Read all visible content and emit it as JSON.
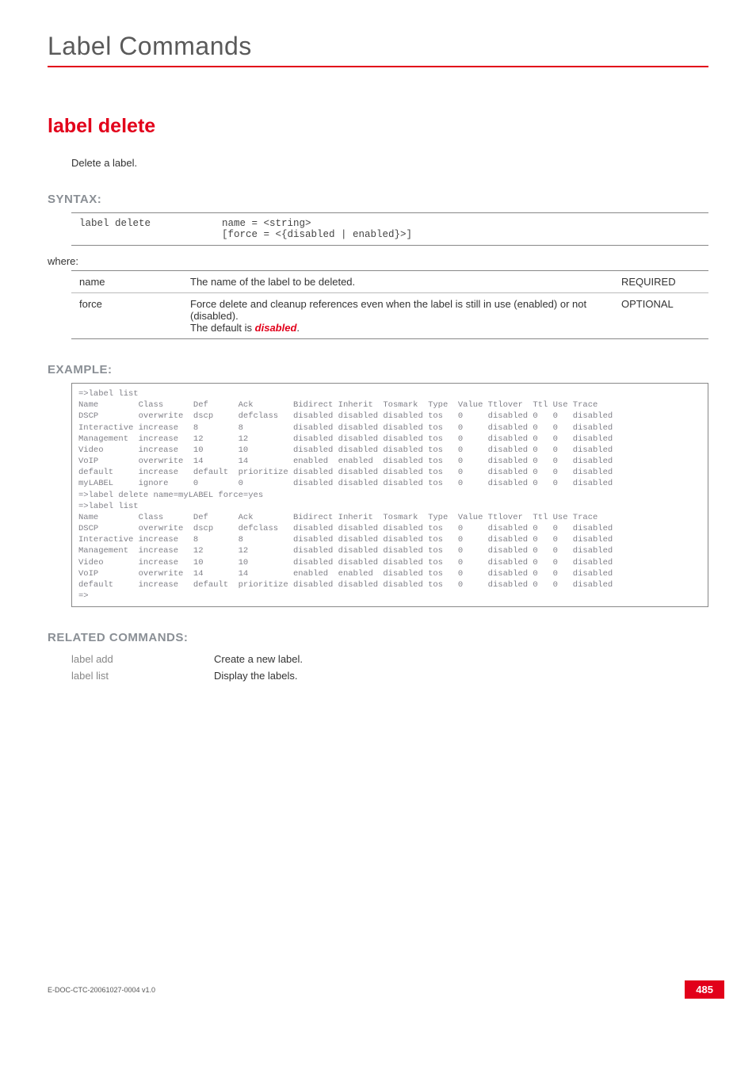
{
  "header": {
    "chapter": "Label Commands"
  },
  "title": "label delete",
  "description": "Delete a label.",
  "sections": {
    "syntax": "SYNTAX:",
    "example": "EXAMPLE:",
    "related": "RELATED COMMANDS:"
  },
  "syntax": {
    "cmd": "label delete",
    "args": "name = <string>\n[force = <{disabled | enabled}>]"
  },
  "where_label": "where:",
  "params": [
    {
      "name": "name",
      "desc_plain": "The name of the label to be deleted.",
      "req": "REQUIRED"
    },
    {
      "name": "force",
      "desc_pre": "Force delete and cleanup references even when the label is still in use (enabled) or not (disabled).\nThe default is ",
      "desc_kw": "disabled",
      "desc_post": ".",
      "req": "OPTIONAL"
    }
  ],
  "example_text": "=>label list\nName        Class      Def      Ack        Bidirect Inherit  Tosmark  Type  Value Ttlover  Ttl Use Trace\nDSCP        overwrite  dscp     defclass   disabled disabled disabled tos   0     disabled 0   0   disabled\nInteractive increase   8        8          disabled disabled disabled tos   0     disabled 0   0   disabled\nManagement  increase   12       12         disabled disabled disabled tos   0     disabled 0   0   disabled\nVideo       increase   10       10         disabled disabled disabled tos   0     disabled 0   0   disabled\nVoIP        overwrite  14       14         enabled  enabled  disabled tos   0     disabled 0   0   disabled\ndefault     increase   default  prioritize disabled disabled disabled tos   0     disabled 0   0   disabled\nmyLABEL     ignore     0        0          disabled disabled disabled tos   0     disabled 0   0   disabled\n=>label delete name=myLABEL force=yes\n=>label list\nName        Class      Def      Ack        Bidirect Inherit  Tosmark  Type  Value Ttlover  Ttl Use Trace\nDSCP        overwrite  dscp     defclass   disabled disabled disabled tos   0     disabled 0   0   disabled\nInteractive increase   8        8          disabled disabled disabled tos   0     disabled 0   0   disabled\nManagement  increase   12       12         disabled disabled disabled tos   0     disabled 0   0   disabled\nVideo       increase   10       10         disabled disabled disabled tos   0     disabled 0   0   disabled\nVoIP        overwrite  14       14         enabled  enabled  disabled tos   0     disabled 0   0   disabled\ndefault     increase   default  prioritize disabled disabled disabled tos   0     disabled 0   0   disabled\n=>",
  "related": [
    {
      "cmd": "label add",
      "text": "Create a new label."
    },
    {
      "cmd": "label list",
      "text": "Display the labels."
    }
  ],
  "footer": {
    "docid": "E-DOC-CTC-20061027-0004 v1.0",
    "pagenum": "485"
  }
}
